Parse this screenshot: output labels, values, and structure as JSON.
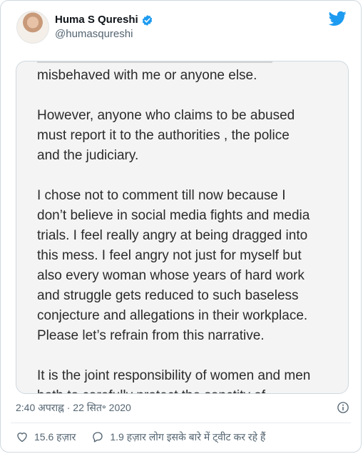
{
  "user": {
    "display_name": "Huma S Qureshi",
    "handle": "@humasqureshi",
    "verified": true
  },
  "icons": {
    "logo": "twitter-bird-icon",
    "verified": "verified-badge-icon",
    "info": "info-icon",
    "like": "heart-icon",
    "reply": "speech-bubble-icon"
  },
  "media_text": {
    "line0": "misbehaved with me or anyone else.",
    "para1": [
      "However, anyone who claims to be abused",
      "must report it to the authorities , the police",
      "and the judiciary."
    ],
    "para2": [
      "I chose not to comment till now because I",
      "don’t believe in social media fights and media",
      "trials. I feel really angry at being dragged into",
      "this mess. I feel angry not just for myself but",
      "also every woman whose years of hard work",
      "and struggle gets reduced to such baseless",
      "conjecture and allegations in their workplace.",
      "Please let’s refrain from this narrative."
    ],
    "para3": [
      "It is the joint responsibility of women and men",
      "both to carefully protect the sanctity of"
    ]
  },
  "timestamp": "2:40 अपराह्न · 22 सित॰ 2020",
  "actions": {
    "likes": "15.6 हज़ार",
    "talking": "1.9 हज़ार लोग इसके बारे में ट्वीट कर रहे हैं"
  },
  "colors": {
    "twitter_blue": "#1d9bf0",
    "text_secondary": "#536471",
    "media_bg": "#f4f4f5"
  }
}
